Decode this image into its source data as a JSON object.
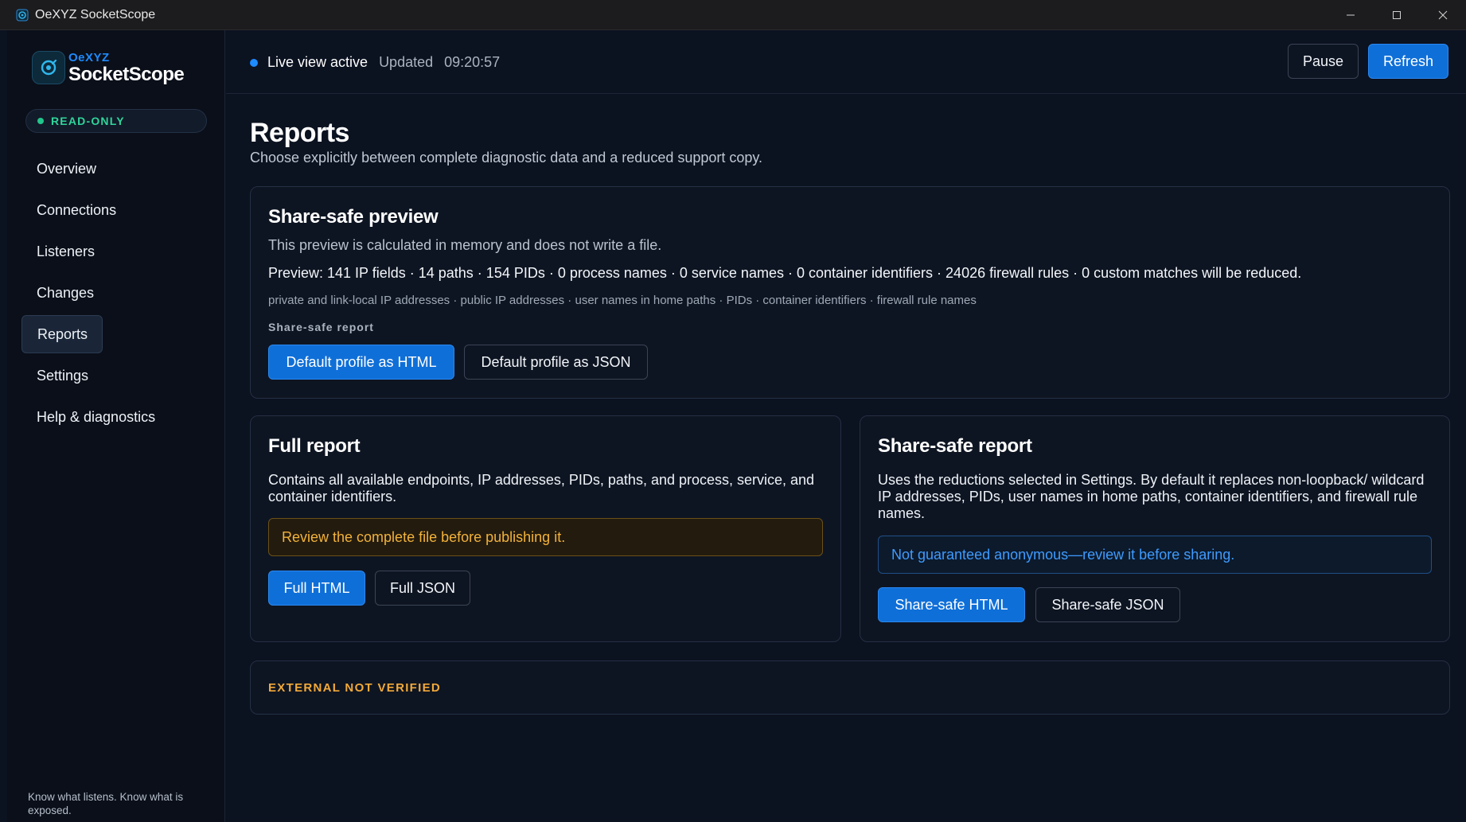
{
  "window": {
    "title": "OeXYZ SocketScope",
    "controls": {
      "minimize": "—",
      "maximize": "☐",
      "close": "✕"
    }
  },
  "sidebar": {
    "brand_top": "OeXYZ",
    "brand_name": "SocketScope",
    "mode_label": "READ-ONLY",
    "items": [
      {
        "label": "Overview",
        "active": false
      },
      {
        "label": "Connections",
        "active": false
      },
      {
        "label": "Listeners",
        "active": false
      },
      {
        "label": "Changes",
        "active": false
      },
      {
        "label": "Reports",
        "active": true
      },
      {
        "label": "Settings",
        "active": false
      },
      {
        "label": "Help & diagnostics",
        "active": false
      }
    ],
    "tagline": "Know what listens. Know what is exposed."
  },
  "topbar": {
    "live_label": "Live view active",
    "updated_label": "Updated",
    "updated_time": "09:20:57",
    "pause_label": "Pause",
    "refresh_label": "Refresh"
  },
  "page": {
    "title": "Reports",
    "subtitle": "Choose explicitly between complete diagnostic data and a reduced support copy."
  },
  "preview_card": {
    "title": "Share-safe preview",
    "description": "This preview is calculated in memory and does not write a file.",
    "preview": "Preview: 141 IP fields · 14 paths · 154 PIDs · 0 process names · 0 service names · 0 container identifiers · 24026 firewall rules · 0 custom matches will be reduced.",
    "categories": "private and link-local IP addresses · public IP addresses · user names in home paths · PIDs · container identifiers · firewall rule names",
    "section_label": "Share-safe report",
    "html_button": "Default profile as HTML",
    "json_button": "Default profile as JSON"
  },
  "full_card": {
    "title": "Full report",
    "description": "Contains all available endpoints, IP addresses, PIDs, paths, and process, service, and container identifiers.",
    "warning": "Review the complete file before publishing it.",
    "html_button": "Full HTML",
    "json_button": "Full JSON"
  },
  "safe_card": {
    "title": "Share-safe report",
    "description": "Uses the reductions selected in Settings. By default it replaces non-loopback/ wildcard IP addresses, PIDs, user names in home paths, container identifiers, and firewall rule names.",
    "notice": "Not guaranteed anonymous—review it before sharing.",
    "html_button": "Share-safe HTML",
    "json_button": "Share-safe JSON"
  },
  "external_card": {
    "status": "EXTERNAL NOT VERIFIED"
  },
  "colors": {
    "accent": "#0f6fd8",
    "success": "#22c58b",
    "warning": "#f2b23a",
    "info": "#3f9bff",
    "background": "#0b1220"
  }
}
